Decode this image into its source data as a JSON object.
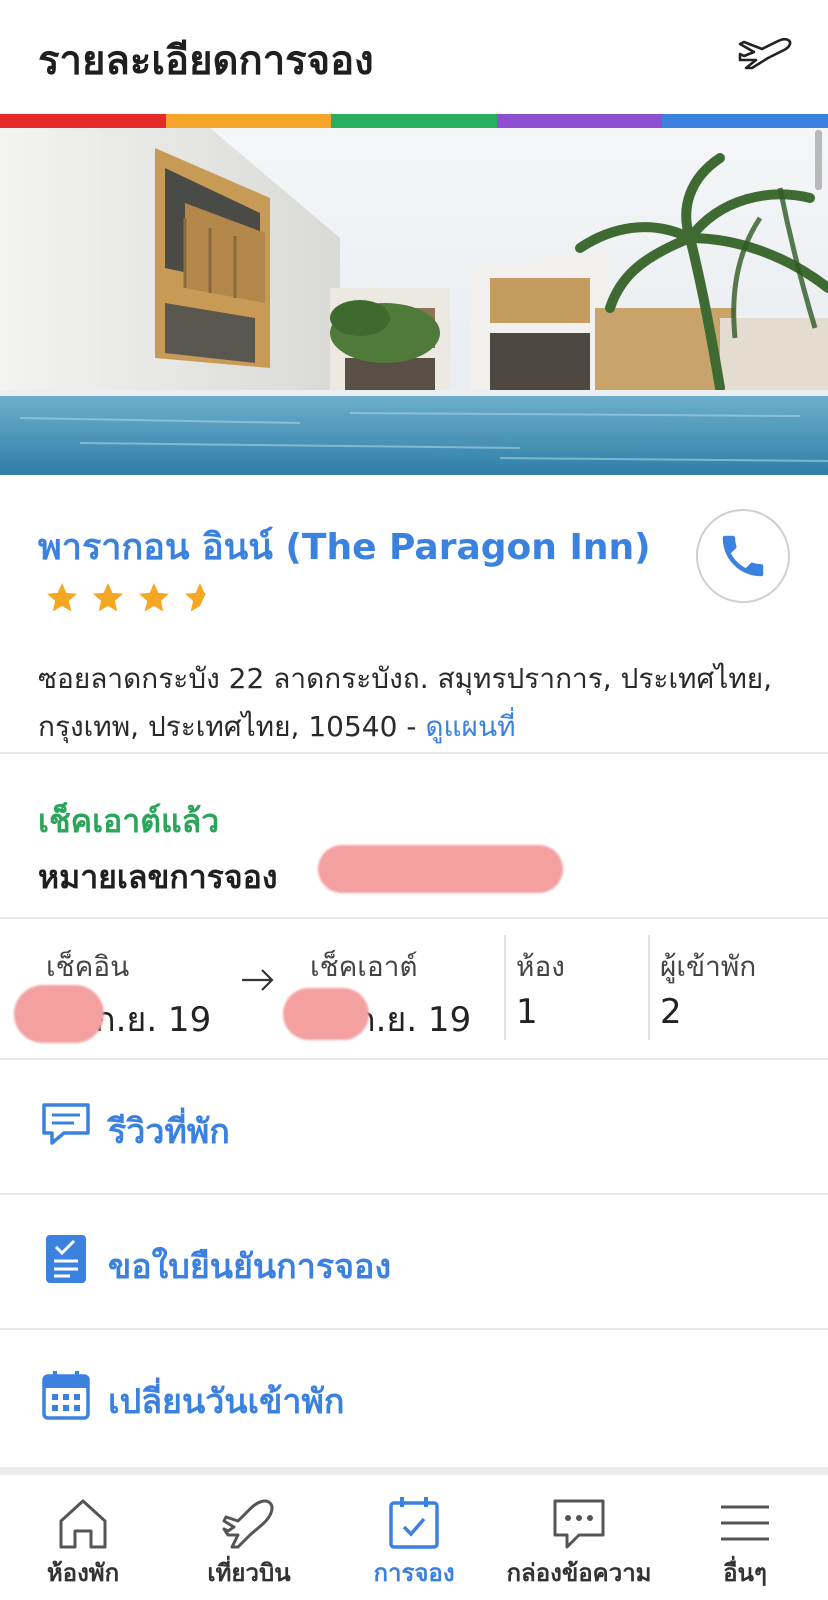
{
  "header": {
    "title": "รายละเอียดการจอง"
  },
  "colors": {
    "accent": "#3b82e0",
    "status_green": "#2aa55a",
    "stripes": [
      "#e62a2a",
      "#f7a52b",
      "#27ae5f",
      "#8e4fd0",
      "#3b82e0"
    ]
  },
  "hotel": {
    "name": "พารากอน อินน์ (The Paragon Inn)",
    "rating": 3.5,
    "address_line": "ซอยลาดกระบัง 22 ลาดกระบังถ. สมุทรปราการ, ประเทศไทย, กรุงเทพ, ประเทศไทย, 10540 - ",
    "map_link": "ดูแผนที่"
  },
  "booking": {
    "status": "เช็คเอาต์แล้ว",
    "number_label": "หมายเลขการจอง"
  },
  "stay": {
    "checkin_label": "เช็คอิน",
    "checkin_value": "ก.ย. 19",
    "checkout_label": "เช็คเอาต์",
    "checkout_value": "ก.ย. 19",
    "rooms_label": "ห้อง",
    "rooms_value": "1",
    "guests_label": "ผู้เข้าพัก",
    "guests_value": "2"
  },
  "actions": [
    {
      "label": "รีวิวที่พัก",
      "icon": "chat-bubble-icon"
    },
    {
      "label": "ขอใบยืนยันการจอง",
      "icon": "document-check-icon"
    },
    {
      "label": "เปลี่ยนวันเข้าพัก",
      "icon": "calendar-icon"
    }
  ],
  "tabbar": {
    "items": [
      {
        "label": "ห้องพัก",
        "icon": "home-icon"
      },
      {
        "label": "เที่ยวบิน",
        "icon": "plane-icon"
      },
      {
        "label": "การจอง",
        "icon": "calendar-check-icon",
        "active": true
      },
      {
        "label": "กล่องข้อความ",
        "icon": "message-icon"
      },
      {
        "label": "อื่นๆ",
        "icon": "menu-icon"
      }
    ]
  }
}
